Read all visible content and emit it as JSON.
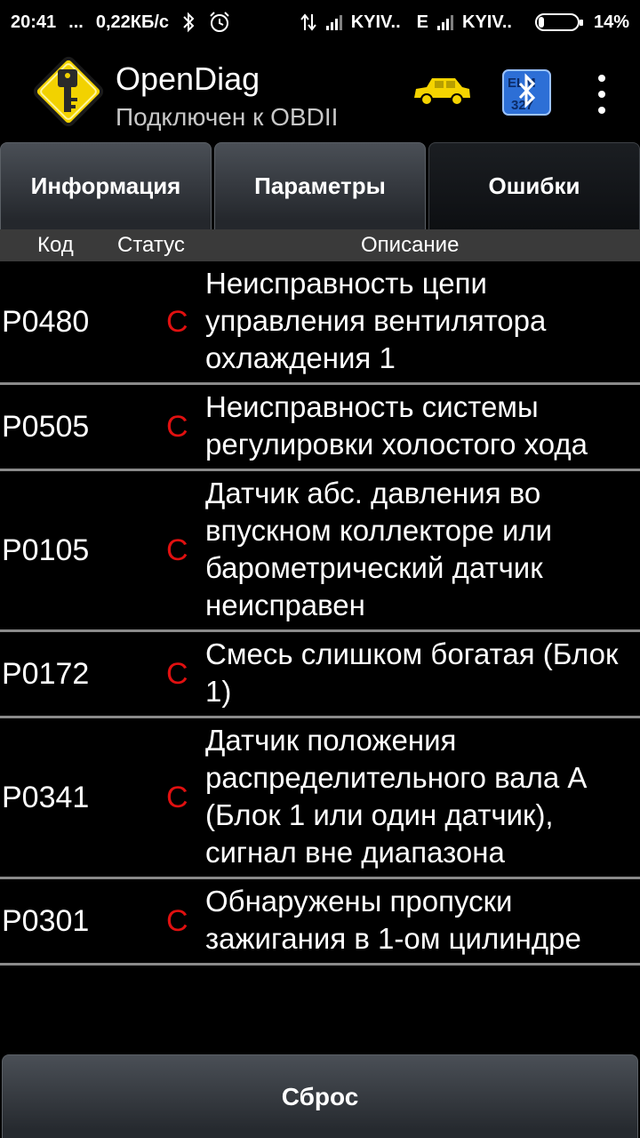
{
  "statusbar": {
    "time": "20:41",
    "dots": "...",
    "speed": "0,22КБ/с",
    "carrier1": "KYIV..",
    "network_type": "E",
    "carrier2": "KYIV..",
    "battery": "14%"
  },
  "app": {
    "title": "OpenDiag",
    "subtitle": "Подключен к OBDII"
  },
  "tabs": [
    {
      "label": "Информация",
      "active": false
    },
    {
      "label": "Параметры",
      "active": false
    },
    {
      "label": "Ошибки",
      "active": true
    }
  ],
  "columns": {
    "code": "Код",
    "status": "Статус",
    "description": "Описание"
  },
  "errors": [
    {
      "code": "P0480",
      "status": "C",
      "description": "Неисправность цепи управления вентилятора охлаждения 1"
    },
    {
      "code": "P0505",
      "status": "C",
      "description": "Неисправность системы регулировки холостого хода"
    },
    {
      "code": "P0105",
      "status": "C",
      "description": "Датчик абс. давления во впускном коллекторе или барометрический датчик неисправен"
    },
    {
      "code": "P0172",
      "status": "C",
      "description": "Смесь слишком богатая (Блок 1)"
    },
    {
      "code": "P0341",
      "status": "C",
      "description": "Датчик положения распределительного вала A (Блок 1 или один датчик), сигнал вне диапазона"
    },
    {
      "code": "P0301",
      "status": "C",
      "description": "Обнаружены пропуски зажигания в 1-ом цилиндре"
    }
  ],
  "reset_label": "Сброс",
  "icons": {
    "logo": "key-warning-icon",
    "car": "car-icon",
    "bluetooth": "bluetooth-elm327-icon",
    "menu": "overflow-menu-icon"
  },
  "colors": {
    "status_error": "#e01010",
    "logo_yellow": "#f2d200",
    "car_yellow": "#f5d400"
  }
}
